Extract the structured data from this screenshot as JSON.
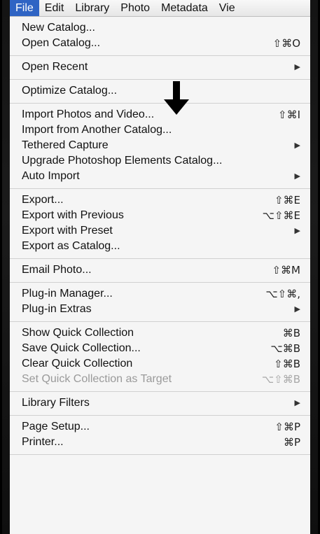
{
  "menubar": {
    "items": [
      "File",
      "Edit",
      "Library",
      "Photo",
      "Metadata",
      "Vie"
    ]
  },
  "menu": {
    "groups": [
      [
        {
          "label": "New Catalog...",
          "shortcut": ""
        },
        {
          "label": "Open Catalog...",
          "shortcut": "⇧⌘O"
        }
      ],
      [
        {
          "label": "Open Recent",
          "submenu": "▶"
        }
      ],
      [
        {
          "label": "Optimize Catalog...",
          "shortcut": ""
        }
      ],
      [
        {
          "label": "Import Photos and Video...",
          "shortcut": "⇧⌘I"
        },
        {
          "label": "Import from Another Catalog...",
          "shortcut": ""
        },
        {
          "label": "Tethered Capture",
          "submenu": "▶"
        },
        {
          "label": "Upgrade Photoshop Elements Catalog...",
          "shortcut": ""
        },
        {
          "label": "Auto Import",
          "submenu": "▶"
        }
      ],
      [
        {
          "label": "Export...",
          "shortcut": "⇧⌘E"
        },
        {
          "label": "Export with Previous",
          "shortcut": "⌥⇧⌘E"
        },
        {
          "label": "Export with Preset",
          "submenu": "▶"
        },
        {
          "label": "Export as Catalog...",
          "shortcut": ""
        }
      ],
      [
        {
          "label": "Email Photo...",
          "shortcut": "⇧⌘M"
        }
      ],
      [
        {
          "label": "Plug-in Manager...",
          "shortcut": "⌥⇧⌘,"
        },
        {
          "label": "Plug-in Extras",
          "submenu": "▶"
        }
      ],
      [
        {
          "label": "Show Quick Collection",
          "shortcut": "⌘B"
        },
        {
          "label": "Save Quick Collection...",
          "shortcut": "⌥⌘B"
        },
        {
          "label": "Clear Quick Collection",
          "shortcut": "⇧⌘B"
        },
        {
          "label": "Set Quick Collection as Target",
          "shortcut": "⌥⇧⌘B",
          "disabled": true
        }
      ],
      [
        {
          "label": "Library Filters",
          "submenu": "▶"
        }
      ],
      [
        {
          "label": "Page Setup...",
          "shortcut": "⇧⌘P"
        },
        {
          "label": "Printer...",
          "shortcut": "⌘P"
        }
      ]
    ]
  },
  "annotation": {
    "icon": "down-arrow-icon",
    "color": "#000000"
  },
  "colors": {
    "menubar_active": "#2f64c4",
    "menu_bg": "#f5f5f5"
  }
}
